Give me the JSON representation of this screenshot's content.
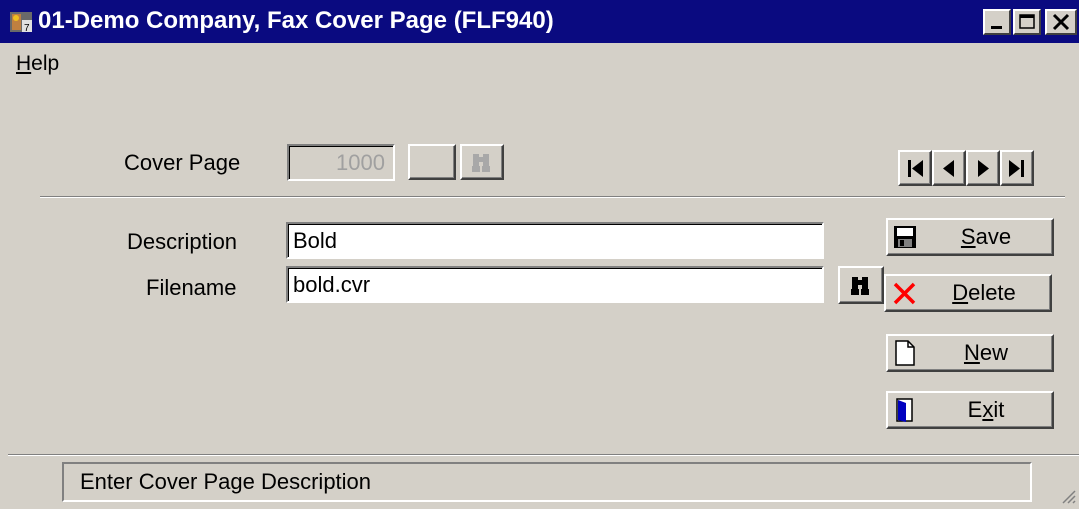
{
  "window": {
    "title": "01-Demo Company, Fax Cover Page (FLF940)",
    "icon": "app-icon"
  },
  "menu": {
    "items": [
      {
        "label": "Help",
        "mnemonic": "H"
      }
    ]
  },
  "form": {
    "cover_page_label": "Cover Page",
    "cover_page_value": "1000",
    "description_label": "Description",
    "description_value": "Bold",
    "filename_label": "Filename",
    "filename_value": "bold.cvr"
  },
  "navigation": {
    "buttons": [
      "first-record-icon",
      "previous-record-icon",
      "next-record-icon",
      "last-record-icon"
    ]
  },
  "actions": {
    "save": {
      "label": "Save",
      "icon": "floppy-disk-icon"
    },
    "delete": {
      "label": "Delete",
      "icon": "red-x-icon"
    },
    "new": {
      "label": "New",
      "icon": "blank-page-icon"
    },
    "exit": {
      "label": "Exit",
      "icon": "door-icon"
    }
  },
  "status": {
    "message": "Enter Cover Page Description"
  },
  "colors": {
    "titlebar": "#0a0a80",
    "face": "#d4d0c8",
    "delete_x": "#ff0000"
  }
}
